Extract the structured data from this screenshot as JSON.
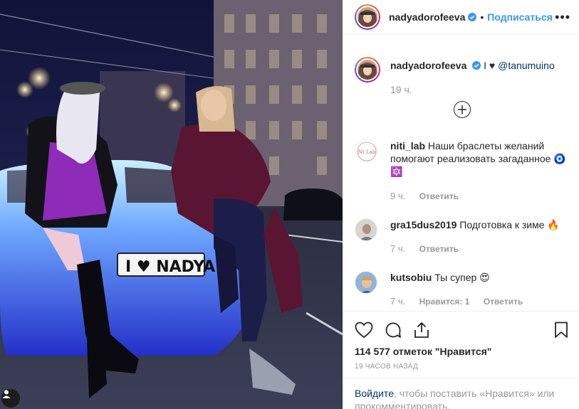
{
  "post": {
    "username": "nadyadorofeeva",
    "follow_label": "Подписаться",
    "dot": "•",
    "more_label": "•••",
    "photo": {
      "plate_text": "I ♥ NADYA"
    }
  },
  "caption": {
    "username": "nadyadorofeeva",
    "text": "I ♥ ",
    "mention": "@tanumuino",
    "time": "19 ч."
  },
  "comments": [
    {
      "username": "niti_lab",
      "text": "Наши браслеты желаний помогают реализовать загаданное 🧿🔯",
      "time": "9 ч.",
      "reply": "Ответить",
      "likes": "",
      "avatar_text": "Nt Lab"
    },
    {
      "username": "gra15dus2019",
      "text": "Подготовка к зиме 🔥",
      "time": "7 ч.",
      "reply": "Ответить",
      "likes": ""
    },
    {
      "username": "kutsobiu",
      "text": "Ты супер 😍",
      "time": "7 ч.",
      "reply": "Ответить",
      "likes": "Нравится: 1"
    }
  ],
  "stats": {
    "likes": "114 577 отметок \"Нравится\"",
    "time_ago": "19 ЧАСОВ НАЗАД"
  },
  "login": {
    "link": "Войдите",
    "text": ", чтобы поставить «Нравится» или прокомментировать."
  },
  "colors": {
    "link": "#3897f0",
    "mention": "#003569",
    "meta": "#999999"
  }
}
